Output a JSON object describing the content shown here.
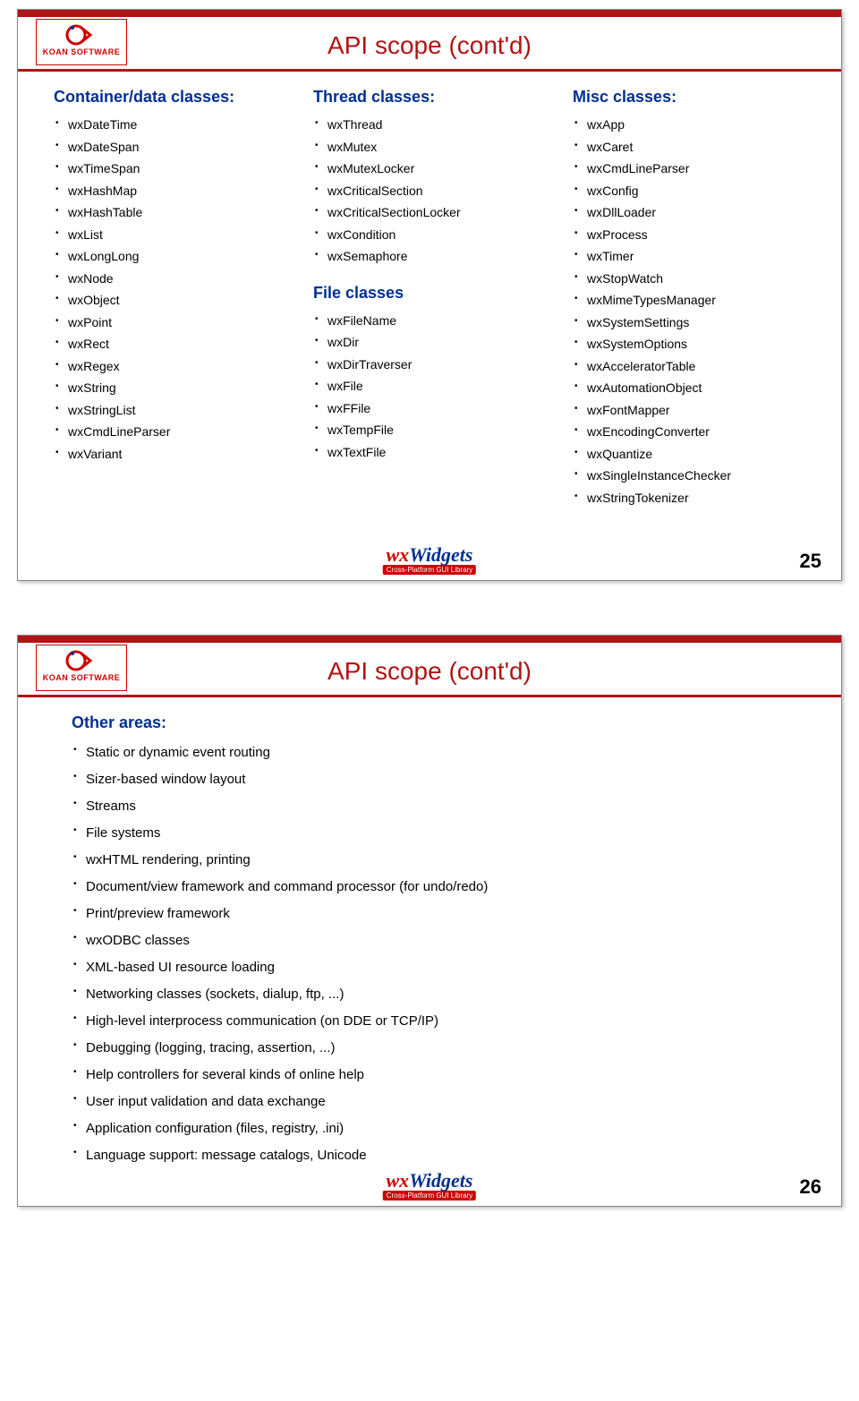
{
  "slide25": {
    "title": "API scope (cont'd)",
    "page": "25",
    "col1": {
      "heading": "Container/data classes:",
      "items": [
        "wxDateTime",
        "wxDateSpan",
        "wxTimeSpan",
        "wxHashMap",
        "wxHashTable",
        "wxList",
        "wxLongLong",
        "wxNode",
        "wxObject",
        "wxPoint",
        "wxRect",
        "wxRegex",
        "wxString",
        "wxStringList",
        "wxCmdLineParser",
        "wxVariant"
      ]
    },
    "col2a": {
      "heading": "Thread classes:",
      "items": [
        "wxThread",
        "wxMutex",
        "wxMutexLocker",
        "wxCriticalSection",
        "wxCriticalSectionLocker",
        "wxCondition",
        "wxSemaphore"
      ]
    },
    "col2b": {
      "heading": "File classes",
      "items": [
        "wxFileName",
        "wxDir",
        "wxDirTraverser",
        "wxFile",
        "wxFFile",
        "wxTempFile",
        "wxTextFile"
      ]
    },
    "col3": {
      "heading": "Misc classes:",
      "items": [
        "wxApp",
        "wxCaret",
        "wxCmdLineParser",
        "wxConfig",
        "wxDllLoader",
        "wxProcess",
        "wxTimer",
        "wxStopWatch",
        "wxMimeTypesManager",
        "wxSystemSettings",
        "wxSystemOptions",
        "wxAcceleratorTable",
        "wxAutomationObject",
        "wxFontMapper",
        "wxEncodingConverter",
        "wxQuantize",
        "wxSingleInstanceChecker",
        "wxStringTokenizer"
      ]
    }
  },
  "slide26": {
    "title": "API scope (cont'd)",
    "page": "26",
    "heading": "Other areas:",
    "items": [
      "Static or dynamic event routing",
      "Sizer-based window layout",
      "Streams",
      "File systems",
      "wxHTML rendering, printing",
      "Document/view framework and command processor (for undo/redo)",
      "Print/preview framework",
      "wxODBC classes",
      "XML-based UI resource loading",
      "Networking classes (sockets, dialup, ftp, ...)",
      "High-level interprocess communication (on DDE or TCP/IP)",
      "Debugging (logging, tracing, assertion, ...)",
      "Help controllers for several kinds of online help",
      "User input validation and data exchange",
      "Application configuration (files, registry, .ini)",
      "Language support: message catalogs, Unicode"
    ]
  },
  "branding": {
    "koan": "KOAN SOFTWARE",
    "wx_prefix": "wx",
    "wx_suffix": "Widgets",
    "tag": "Cross-Platform GUI Library"
  }
}
